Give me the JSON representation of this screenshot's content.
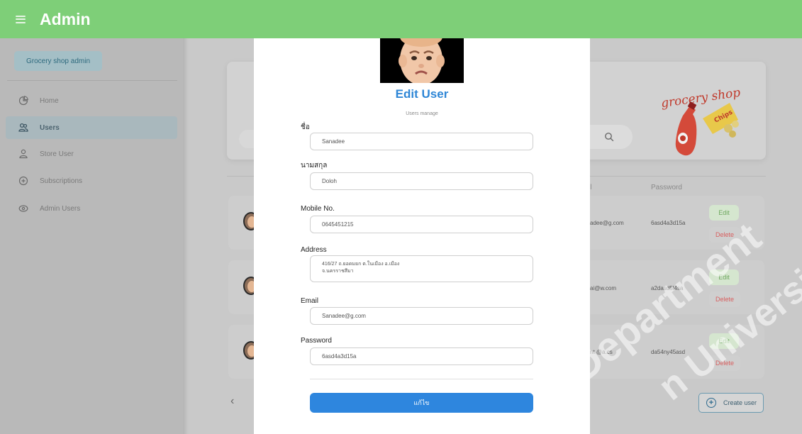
{
  "header": {
    "title": "Admin"
  },
  "sidebar": {
    "shop_badge": "Grocery shop admin",
    "items": [
      {
        "label": "Home",
        "icon": "pie-chart-icon"
      },
      {
        "label": "Users",
        "icon": "users-icon",
        "active": true
      },
      {
        "label": "Store User",
        "icon": "user-icon"
      },
      {
        "label": "Subscriptions",
        "icon": "plus-circle-icon"
      },
      {
        "label": "Admin Users",
        "icon": "eye-icon"
      }
    ]
  },
  "logo": {
    "text": "grocery shop"
  },
  "table": {
    "headers": {
      "email": "il",
      "password": "Password"
    },
    "rows": [
      {
        "email": "adee@g.com",
        "password": "6asd4a3d15a"
      },
      {
        "email": "ai@w.com",
        "password": "a2dasd5l4sa"
      },
      {
        "email": "nt @a.cs",
        "password": "da54ny45asd"
      }
    ],
    "edit_label": "Edit",
    "delete_label": "Delete"
  },
  "pagination": {
    "prev": "‹"
  },
  "create_button": {
    "label": "Create user"
  },
  "watermark": {
    "line1": "Department",
    "line2": "n University"
  },
  "modal": {
    "title": "Edit User",
    "subtitle": "Users manage",
    "fields": {
      "first_name": {
        "label": "ชื่อ",
        "value": "Sanadee"
      },
      "last_name": {
        "label": "นามสกุล",
        "value": "Doloh"
      },
      "mobile": {
        "label": "Mobile No.",
        "value": "0645451215"
      },
      "address": {
        "label": "Address",
        "value": "416/27 ถ.ยอดมยก ต.ในเมือง อ.เมือง\nจ.นครราชสีมา"
      },
      "email": {
        "label": "Email",
        "value": "Sanadee@g.com"
      },
      "password": {
        "label": "Password",
        "value": "6asd4a3d15a"
      }
    },
    "submit_label": "แก้ไข"
  },
  "colors": {
    "header": "#7ecf78",
    "accent": "#2e86de",
    "title": "#2e86d6",
    "edit": "#6fa85f",
    "delete": "#d85e5e"
  }
}
